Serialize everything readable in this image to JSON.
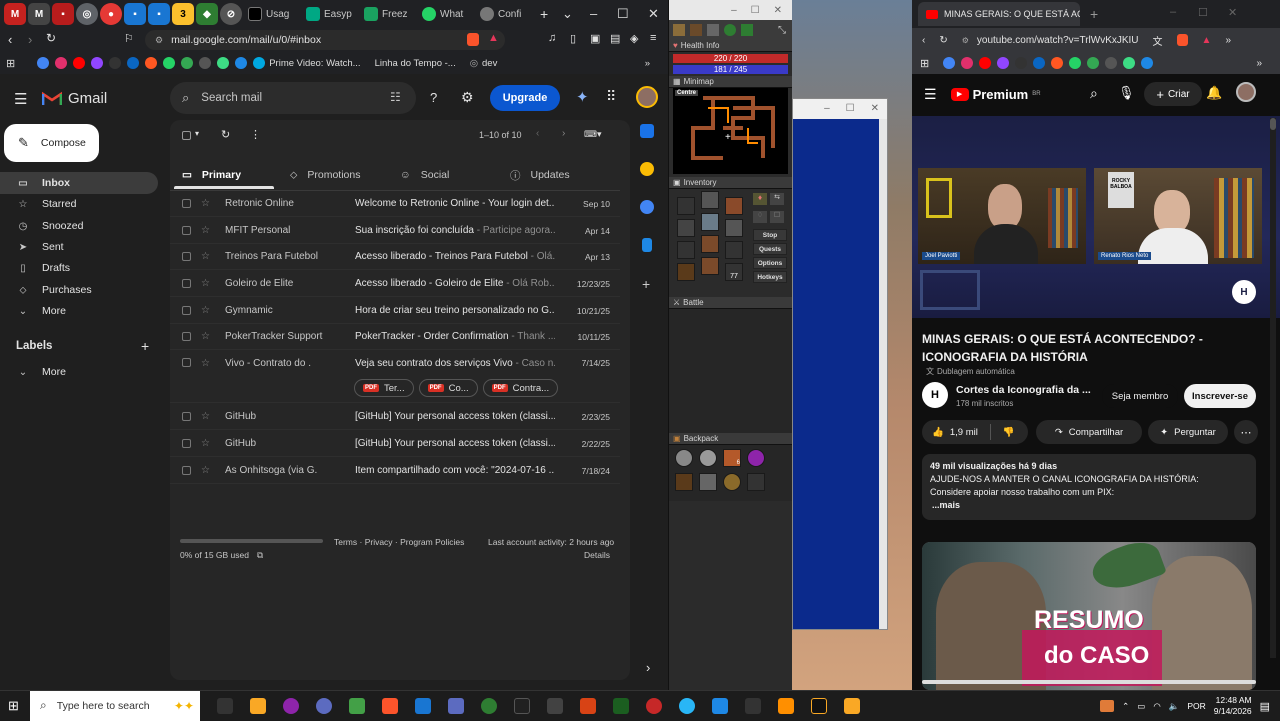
{
  "colors": {
    "gmail_bg": "#1f1f1f",
    "gmail_accent": "#0b57d0",
    "youtube_red": "#ff0000",
    "health_red": "#c12a2a",
    "mana_blue": "#3a3ac8"
  },
  "gmail": {
    "tab_titles": [
      "Usag",
      "Easyp",
      "Freez",
      "What",
      "Confi"
    ],
    "url": "mail.google.com/mail/u/0/#inbox",
    "bookmarks": [
      "Prime Video: Watch...",
      "Linha do Tempo -...",
      "dev"
    ],
    "logo_text": "Gmail",
    "search_placeholder": "Search mail",
    "upgrade_label": "Upgrade",
    "compose_label": "Compose",
    "nav": [
      "Inbox",
      "Starred",
      "Snoozed",
      "Sent",
      "Drafts",
      "Purchases",
      "More"
    ],
    "labels_heading": "Labels",
    "labels_more": "More",
    "pagination": "1–10 of 10",
    "categories": [
      "Primary",
      "Promotions",
      "Social",
      "Updates"
    ],
    "emails": [
      {
        "sender": "Retronic Online",
        "subject": "Welcome to Retronic Online - Your login det...",
        "snippet": "",
        "date": "Sep 10"
      },
      {
        "sender": "MFIT Personal",
        "subject": "Sua inscrição foi concluída",
        "snippet": " - Participe agora...",
        "date": "Apr 14"
      },
      {
        "sender": "Treinos Para Futebol",
        "subject": "Acesso liberado - Treinos Para Futebol",
        "snippet": " - Olá...",
        "date": "Apr 13"
      },
      {
        "sender": "Goleiro de Elite",
        "subject": "Acesso liberado - Goleiro de Elite",
        "snippet": " - Olá Rob...",
        "date": "12/23/25"
      },
      {
        "sender": "Gymnamic",
        "subject": "Hora de criar seu treino personalizado no G...",
        "snippet": "",
        "date": "10/21/25"
      },
      {
        "sender": "PokerTracker Support",
        "subject": "PokerTracker - Order Confirmation",
        "snippet": " - Thank ...",
        "date": "10/11/25"
      },
      {
        "sender": "Vivo - Contrato do .",
        "subject": "Veja seu contrato dos serviços Vivo",
        "snippet": " - Caso n...",
        "date": "7/14/25"
      },
      {
        "sender": "GitHub",
        "subject": "[GitHub] Your personal access token (classi...",
        "snippet": "",
        "date": "2/23/25"
      },
      {
        "sender": "GitHub",
        "subject": "[GitHub] Your personal access token (classi...",
        "snippet": "",
        "date": "2/22/25"
      },
      {
        "sender": "Às Onhitsoga (via G.",
        "subject": "Item compartilhado com você: \"2024-07-16 ...",
        "snippet": "",
        "date": "7/18/24"
      }
    ],
    "attachments": [
      "Ter...",
      "Co...",
      "Contra..."
    ],
    "storage_text": "0% of 15 GB used",
    "footer_links": "Terms · Privacy · Program Policies",
    "activity_text": "Last account activity: 2 hours ago",
    "details_label": "Details"
  },
  "game": {
    "health_title": "Health Info",
    "hp": "220 / 220",
    "mp": "181 / 245",
    "minimap_title": "Minimap",
    "minimap_button": "Centre",
    "inventory_title": "Inventory",
    "inventory_buttons": [
      "Stop",
      "Quests",
      "Options",
      "Hotkeys"
    ],
    "cap_value": "77",
    "battle_title": "Battle",
    "backpack_title": "Backpack",
    "backpack_count": "6"
  },
  "youtube": {
    "tab_title": "MINAS GERAIS: O QUE ESTÁ AC",
    "url": "youtube.com/watch?v=TrlWvKxJKIU",
    "premium_label": "Premium",
    "premium_region": "BR",
    "create_label": "Criar",
    "cam1_name": "Joel Paviotti",
    "cam2_name": "Renato Rios Neto",
    "poster_text": "ROCKY BALBOA",
    "video_title": "MINAS GERAIS: O QUE ESTÁ ACONTECENDO? - ICONOGRAFIA DA HISTÓRIA",
    "dub_label": "Dublagem automática",
    "channel_name": "Cortes da Iconografia da ...",
    "subscribers": "178 mil inscritos",
    "member_label": "Seja membro",
    "subscribe_label": "Inscrever-se",
    "likes": "1,9 mil",
    "share_label": "Compartilhar",
    "ask_label": "Perguntar",
    "views_line": "49 mil visualizações  há 9 dias",
    "desc_line1": "AJUDE-NOS A MANTER O CANAL ICONOGRAFIA DA HISTÓRIA:",
    "desc_line2": "Considere apoiar nosso trabalho com um PIX:",
    "desc_more": "...mais",
    "thumb_word1": "RESUMO",
    "thumb_word2": "do CASO"
  },
  "taskbar": {
    "search_placeholder": "Type here to search",
    "language": "POR",
    "time": "12:48 AM",
    "date": "9/14/2026"
  }
}
